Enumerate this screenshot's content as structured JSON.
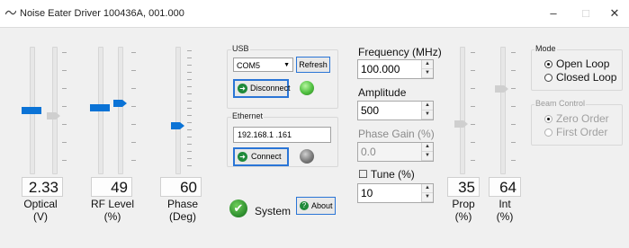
{
  "window": {
    "title": "Noise Eater Driver 100436A, 001.000",
    "minimize": "–",
    "maximize": "□",
    "close": "✕"
  },
  "sliders": {
    "optical": {
      "value": "2.33",
      "caption_line1": "Optical",
      "caption_line2": "(V)",
      "level": 0.55
    },
    "rf_level": {
      "value": "49",
      "caption_line1": "RF Level",
      "caption_line2": "(%)",
      "level": 0.6
    },
    "phase": {
      "value": "60",
      "caption_line1": "Phase",
      "caption_line2": "(Deg)",
      "level": 0.43
    },
    "prop": {
      "value": "35",
      "caption_line1": "Prop",
      "caption_line2": "(%)",
      "level": 0.42
    },
    "int": {
      "value": "64",
      "caption_line1": "Int",
      "caption_line2": "(%)",
      "level": 0.64
    }
  },
  "usb": {
    "label": "USB",
    "port": "COM5",
    "refresh_label": "Refresh",
    "disconnect_label": "Disconnect",
    "led_color": "#4fbf3f"
  },
  "ethernet": {
    "label": "Ethernet",
    "ip": "192.168.1  .161",
    "connect_label": "Connect",
    "led_color": "#7a7a7a"
  },
  "system": {
    "label": "System",
    "about_label": "About"
  },
  "frequency": {
    "label": "Frequency (MHz)",
    "value": "100.000"
  },
  "amplitude": {
    "label": "Amplitude",
    "value": "500"
  },
  "phase_gain": {
    "label": "Phase Gain (%)",
    "value": "0.0"
  },
  "tune": {
    "label": "Tune (%)",
    "value": "10",
    "checkbox": "☐"
  },
  "mode": {
    "label": "Mode",
    "options": [
      "Open Loop",
      "Closed Loop"
    ],
    "selected": "Open Loop"
  },
  "beam_control": {
    "label": "Beam Control",
    "options": [
      "Zero Order",
      "First Order"
    ],
    "selected": "Zero Order"
  },
  "colors": {
    "accent": "#0b73d6",
    "check_green": "#2f8f2f"
  }
}
